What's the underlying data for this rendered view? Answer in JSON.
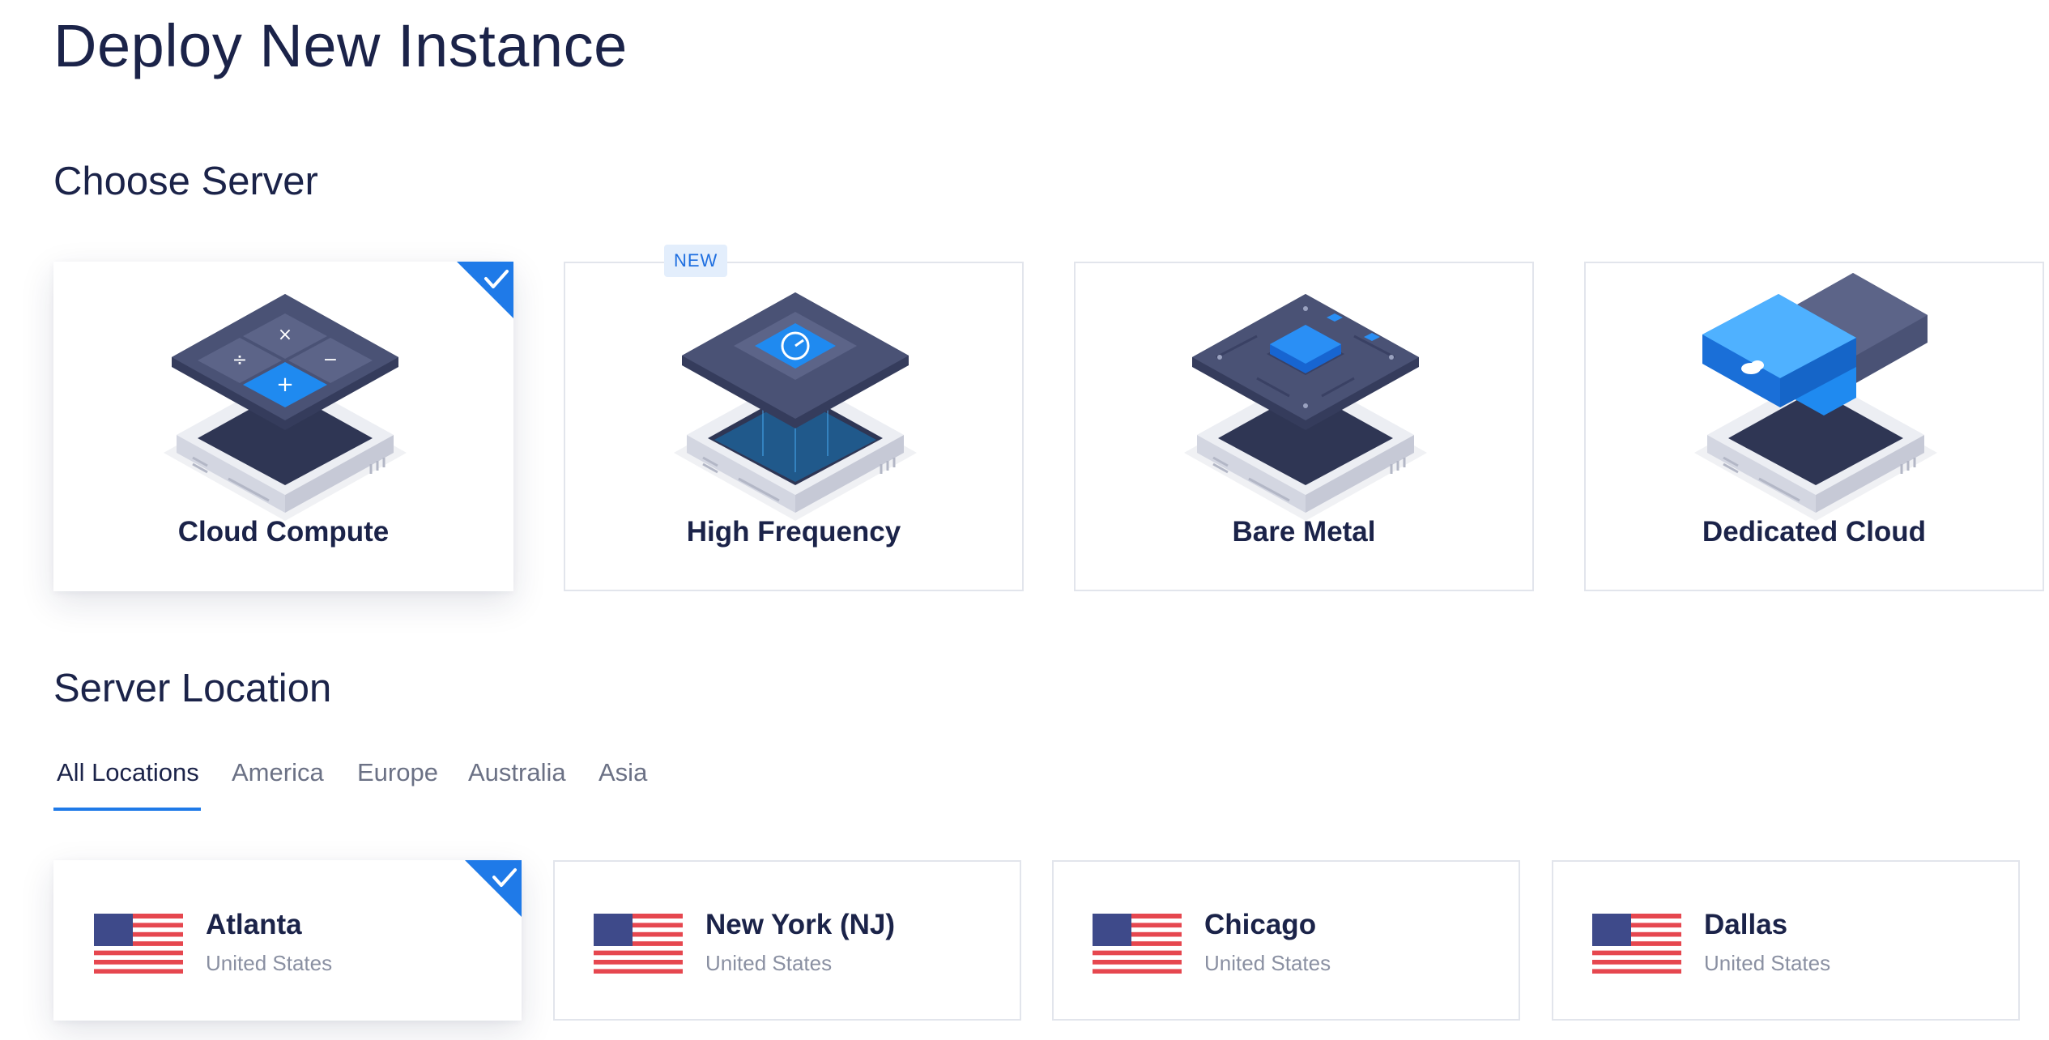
{
  "page": {
    "title": "Deploy New Instance"
  },
  "choose_server": {
    "title": "Choose Server",
    "new_badge": "NEW",
    "selected": "Cloud Compute",
    "cards": [
      {
        "label": "Cloud Compute",
        "icon": "cloud-compute-icon",
        "selected": true
      },
      {
        "label": "High Frequency",
        "icon": "high-frequency-icon",
        "selected": false
      },
      {
        "label": "Bare Metal",
        "icon": "bare-metal-icon",
        "selected": false
      },
      {
        "label": "Dedicated Cloud",
        "icon": "dedicated-cloud-icon",
        "selected": false
      }
    ]
  },
  "server_location": {
    "title": "Server Location",
    "tabs": [
      {
        "label": "All Locations",
        "active": true
      },
      {
        "label": "America",
        "active": false
      },
      {
        "label": "Europe",
        "active": false
      },
      {
        "label": "Australia",
        "active": false
      },
      {
        "label": "Asia",
        "active": false
      }
    ],
    "selected": "Atlanta",
    "locations": [
      {
        "city": "Atlanta",
        "country": "United States",
        "flag": "us-flag-icon",
        "selected": true
      },
      {
        "city": "New York (NJ)",
        "country": "United States",
        "flag": "us-flag-icon",
        "selected": false
      },
      {
        "city": "Chicago",
        "country": "United States",
        "flag": "us-flag-icon",
        "selected": false
      },
      {
        "city": "Dallas",
        "country": "United States",
        "flag": "us-flag-icon",
        "selected": false
      }
    ]
  },
  "colors": {
    "accent": "#1f7ae8",
    "heading": "#1b2349",
    "muted": "#8a90a2",
    "border": "#e2e5ec",
    "badge_bg": "#e3eefc"
  }
}
